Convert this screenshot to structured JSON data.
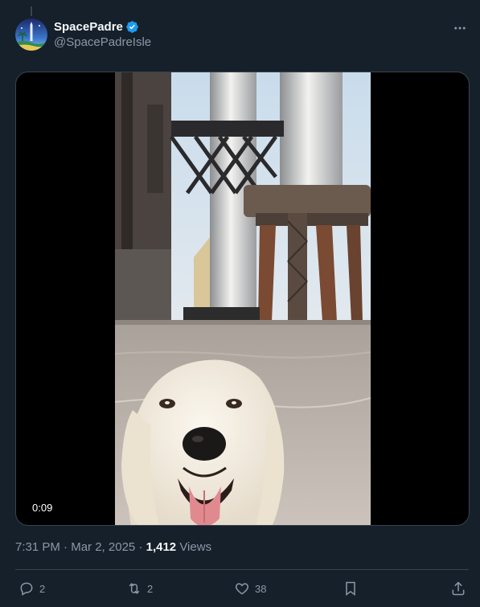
{
  "author": {
    "display_name": "SpacePadre",
    "handle": "@SpacePadreIsle",
    "verified": true
  },
  "media": {
    "type": "video",
    "duration": "0:09"
  },
  "meta": {
    "time": "7:31 PM",
    "separator": "·",
    "date": "Mar 2, 2025",
    "views_count": "1,412",
    "views_label": "Views"
  },
  "actions": {
    "replies": "2",
    "reposts": "2",
    "likes": "38"
  },
  "colors": {
    "background": "#15202b",
    "text": "#f7f9f9",
    "secondary": "#8b98a5",
    "border": "#38444d",
    "verified": "#1d9bf0"
  }
}
